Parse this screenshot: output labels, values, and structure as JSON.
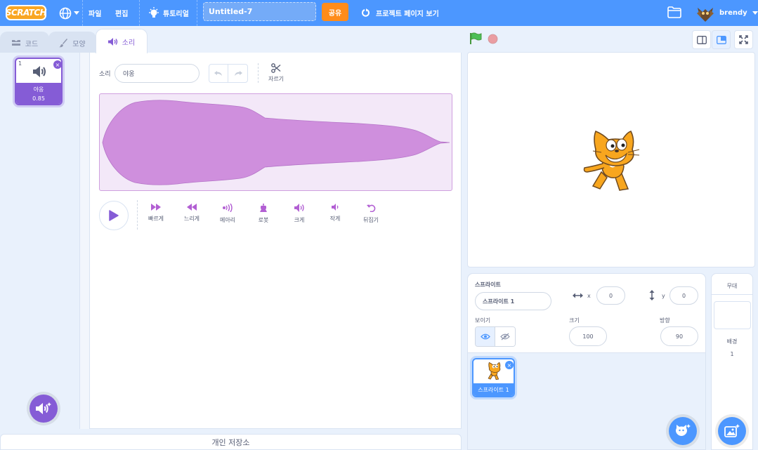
{
  "menubar": {
    "logo": "SCRATCH",
    "file": "파일",
    "edit": "편집",
    "tutorials": "튜토리얼",
    "project_title": "Untitled-7",
    "share": "공유",
    "see_project_page": "프로젝트 페이지 보기",
    "username": "brendy"
  },
  "tabs": [
    {
      "label": "코드",
      "icon": "code-icon"
    },
    {
      "label": "모양",
      "icon": "brush-icon"
    },
    {
      "label": "소리",
      "icon": "speaker-icon",
      "active": true
    }
  ],
  "sound_list": {
    "items": [
      {
        "index": "1",
        "name": "야옹",
        "duration": "0.85"
      }
    ]
  },
  "sound_editor": {
    "sound_label": "소리",
    "sound_name": "야옹",
    "trim_label": "자르기",
    "effects": [
      {
        "label": "빠르게",
        "icon": "faster-icon"
      },
      {
        "label": "느리게",
        "icon": "slower-icon"
      },
      {
        "label": "메아리",
        "icon": "echo-icon"
      },
      {
        "label": "로봇",
        "icon": "robot-icon"
      },
      {
        "label": "크게",
        "icon": "louder-icon"
      },
      {
        "label": "작게",
        "icon": "softer-icon"
      },
      {
        "label": "뒤집기",
        "icon": "reverse-icon"
      }
    ],
    "waveform_color": "#cf8fdd",
    "accent_color": "#855cd6"
  },
  "backpack": "개인 저장소",
  "sprite_info": {
    "sprite_label": "스프라이트",
    "sprite_name": "스프라이트 1",
    "x_label": "x",
    "x": "0",
    "y_label": "y",
    "y": "0",
    "show_label": "보이기",
    "size_label": "크기",
    "size": "100",
    "direction_label": "방향",
    "direction": "90"
  },
  "sprites": [
    {
      "name": "스프라이트 1"
    }
  ],
  "stage_selector": {
    "title": "무대",
    "backdrops_label": "배경",
    "backdrops_count": "1"
  },
  "colors": {
    "menu_blue": "#4c97ff",
    "share_orange": "#ff8c1a",
    "sound_purple": "#855cd6"
  }
}
